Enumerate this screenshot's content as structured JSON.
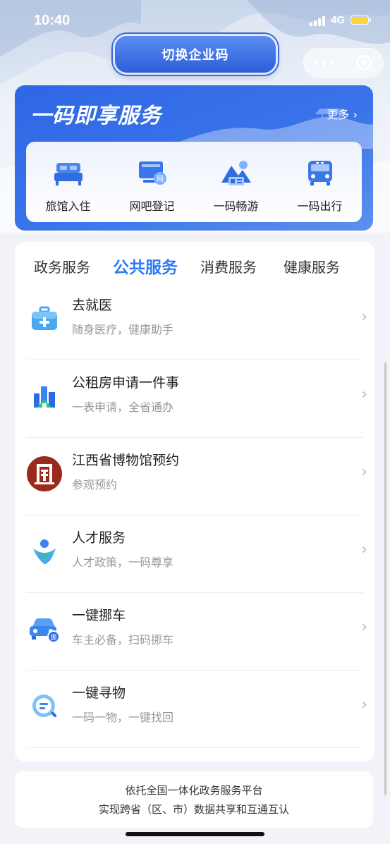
{
  "status_bar": {
    "time": "10:40",
    "network": "4G"
  },
  "header": {
    "switch_label": "切换企业码"
  },
  "service_card": {
    "title": "一码即享服务",
    "more_label": "更多",
    "quick_items": [
      {
        "label": "旅馆入住",
        "icon": "hotel-bed-icon"
      },
      {
        "label": "网吧登记",
        "icon": "internet-cafe-icon"
      },
      {
        "label": "一码畅游",
        "icon": "scenic-tour-icon"
      },
      {
        "label": "一码出行",
        "icon": "bus-travel-icon"
      }
    ]
  },
  "tabs": [
    {
      "label": "政务服务",
      "active": false
    },
    {
      "label": "公共服务",
      "active": true
    },
    {
      "label": "消费服务",
      "active": false
    },
    {
      "label": "健康服务",
      "active": false
    }
  ],
  "services": [
    {
      "title": "去就医",
      "subtitle": "随身医疗，健康助手",
      "icon": "medical-kit-icon"
    },
    {
      "title": "公租房申请一件事",
      "subtitle": "一表申请，全省通办",
      "icon": "public-housing-icon"
    },
    {
      "title": "江西省博物馆预约",
      "subtitle": "参观预约",
      "icon": "museum-logo-icon"
    },
    {
      "title": "人才服务",
      "subtitle": "人才政策，一码尊享",
      "icon": "talent-person-icon"
    },
    {
      "title": "一键挪车",
      "subtitle": "车主必备，扫码挪车",
      "icon": "move-car-icon"
    },
    {
      "title": "一键寻物",
      "subtitle": "一码一物，一键找回",
      "icon": "find-item-icon"
    }
  ],
  "footer": {
    "line1": "依托全国一体化政务服务平台",
    "line2": "实现跨省（区、市）数据共享和互通互认"
  },
  "colors": {
    "primary": "#2f7cf6",
    "card_blue": "#3a74ea",
    "background": "#f1f3f8"
  }
}
